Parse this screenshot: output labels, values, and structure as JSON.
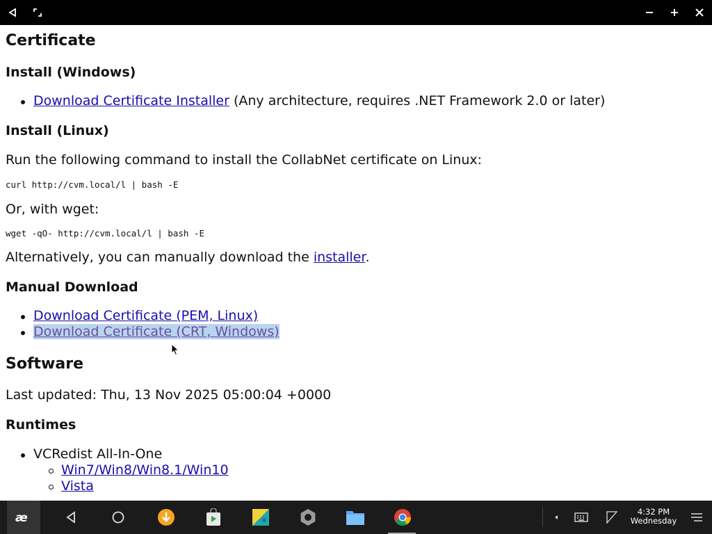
{
  "window": {
    "title_bar_buttons": [
      "back-icon",
      "restore-icon",
      "minimize-icon",
      "maximize-icon",
      "close-icon"
    ]
  },
  "page": {
    "certificate_heading": "Certificate",
    "install_windows_heading": "Install (Windows)",
    "install_windows_link": "Download Certificate Installer",
    "install_windows_note": "(Any architecture, requires .NET Framework 2.0 or later)",
    "install_linux_heading": "Install (Linux)",
    "install_linux_text": "Run the following command to install the CollabNet certificate on Linux:",
    "curl_command": "curl http://cvm.local/l | bash -E",
    "wget_intro": "Or, with wget:",
    "wget_command": "wget -qO- http://cvm.local/l | bash -E",
    "alt_text_before": "Alternatively, you can manually download the ",
    "alt_link": "installer",
    "alt_text_after": ".",
    "manual_download_heading": "Manual Download",
    "manual_links": [
      "Download Certificate (PEM, Linux)",
      "Download Certificate (CRT, Windows)"
    ],
    "software_heading": "Software",
    "last_updated": "Last updated: Thu, 13 Nov 2025 05:00:04 +0000",
    "runtimes_heading": "Runtimes",
    "runtime_item": "VCRedist All-In-One",
    "runtime_sub_links": [
      "Win7/Win8/Win8.1/Win10",
      "Vista"
    ]
  },
  "taskbar": {
    "apps": [
      "start-icon",
      "back-nav-icon",
      "home-icon",
      "downloader-app-icon",
      "store-app-icon",
      "gallery-app-icon",
      "settings-app-icon",
      "files-app-icon",
      "chrome-app-icon"
    ],
    "tray": [
      "tray-arrow-icon",
      "keyboard-icon",
      "sd-card-icon",
      "notifications-icon"
    ],
    "time": "4:32 PM",
    "day": "Wednesday"
  },
  "colors": {
    "link": "#1a0dab",
    "visited_link": "#6a4ea0",
    "selection": "#b9d4ee",
    "taskbar_bg": "#1b1b1b"
  }
}
